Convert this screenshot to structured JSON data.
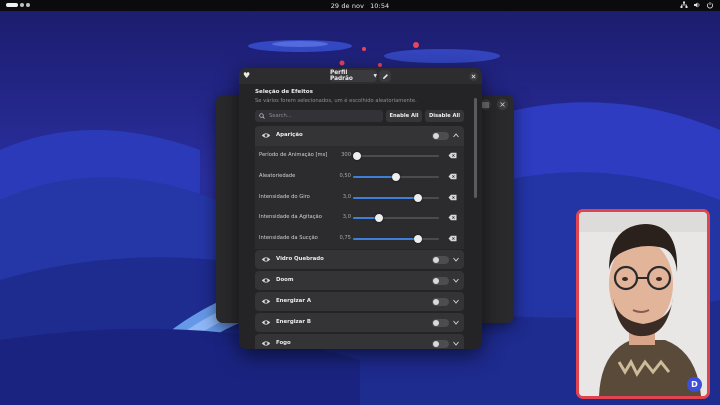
{
  "topbar": {
    "date": "29 de nov",
    "time": "10:54"
  },
  "dialog": {
    "profile_label": "Perfil Padrão",
    "section_title": "Seleção de Efeitos",
    "section_subtitle": "Se vários forem selecionados, um é escolhido aleatoriamente.",
    "search_placeholder": "Search...",
    "enable_all_label": "Enable All",
    "disable_all_label": "Disable All",
    "expanded_effect": {
      "name": "Aparição",
      "enabled": false,
      "params": [
        {
          "label": "Período de Animação [ms]",
          "value": "300",
          "level": 0.05
        },
        {
          "label": "Aleatoriedade",
          "value": "0,50",
          "level": 0.5
        },
        {
          "label": "Intensidade do Giro",
          "value": "3,0",
          "level": 0.75
        },
        {
          "label": "Intensidade da Agitação",
          "value": "3,0",
          "level": 0.3
        },
        {
          "label": "Intensidade da Sucção",
          "value": "0,75",
          "level": 0.75
        }
      ]
    },
    "effects": [
      {
        "name": "Vidro Quebrado",
        "enabled": false
      },
      {
        "name": "Doom",
        "enabled": false
      },
      {
        "name": "Energizar A",
        "enabled": false
      },
      {
        "name": "Energizar B",
        "enabled": false
      },
      {
        "name": "Fogo",
        "enabled": false
      }
    ]
  },
  "icons": {
    "activities": "activities-indicator",
    "tray": [
      "network-icon",
      "volume-icon",
      "power-icon"
    ],
    "dialog_menu": "heart-icon",
    "edit": "pencil-icon",
    "close": "close-icon",
    "row_visibility": "eye-icon",
    "reset": "reset-icon",
    "expand": "chevron-down-icon",
    "collapse": "chevron-up-icon",
    "camera_badge": "channel-logo-icon"
  },
  "colors": {
    "accent": "#3d7fd9",
    "dialog_bg": "#242427",
    "camera_border": "#e0444f"
  }
}
